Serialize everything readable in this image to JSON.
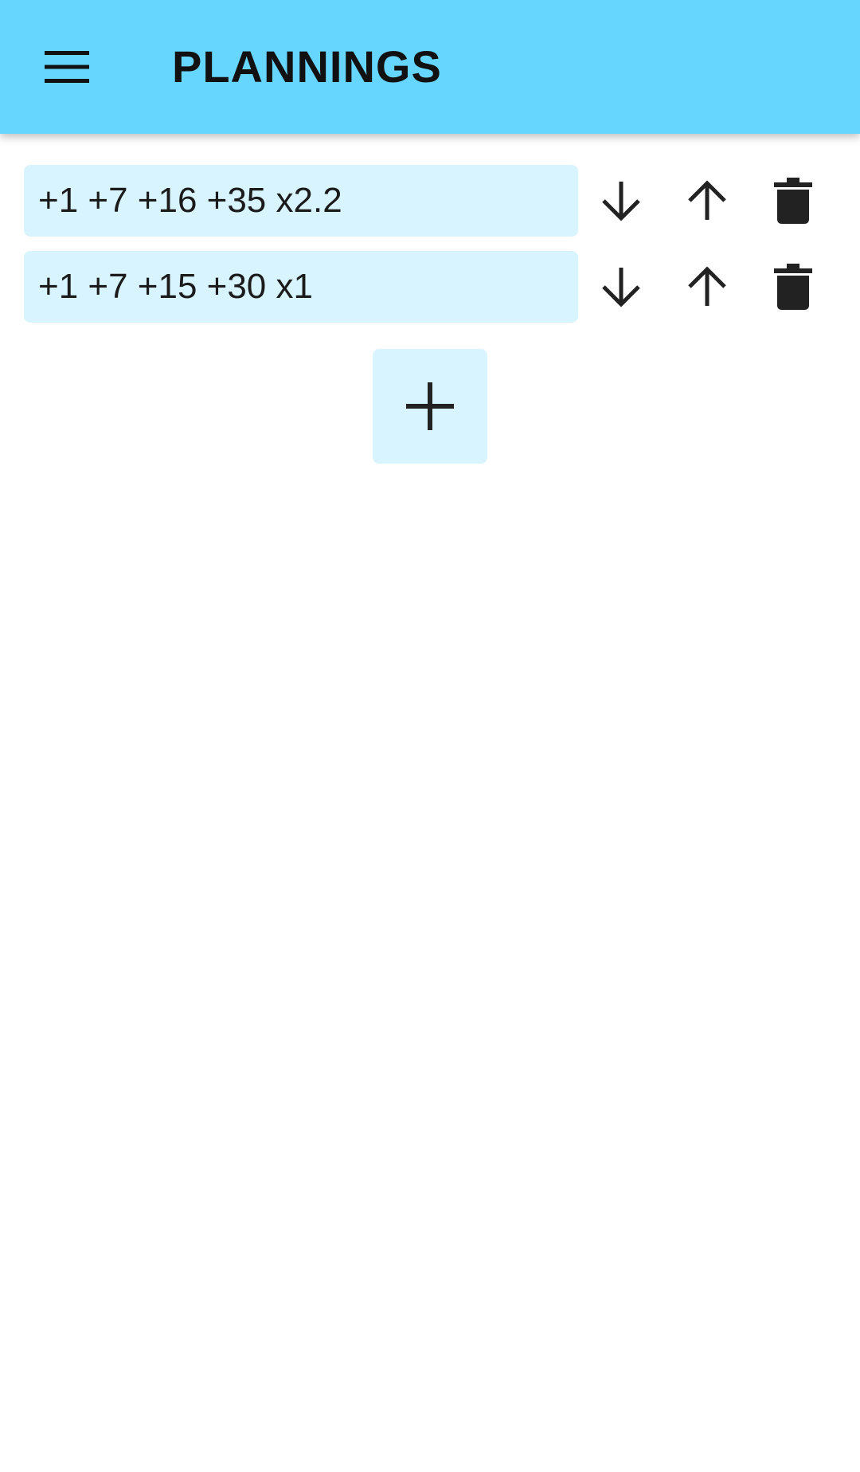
{
  "app": {
    "title": "PLANNINGS",
    "accent_color": "#66d6ff",
    "field_color": "#d8f4fe"
  },
  "header": {
    "menu_icon": "hamburger-menu-icon"
  },
  "plannings": [
    {
      "value": "+1 +7 +16 +35 x2.2"
    },
    {
      "value": "+1 +7 +15 +30 x1"
    }
  ],
  "row_actions": {
    "move_down_icon": "arrow-down-icon",
    "move_up_icon": "arrow-up-icon",
    "delete_icon": "trash-icon"
  },
  "add_button": {
    "icon": "plus-icon"
  }
}
